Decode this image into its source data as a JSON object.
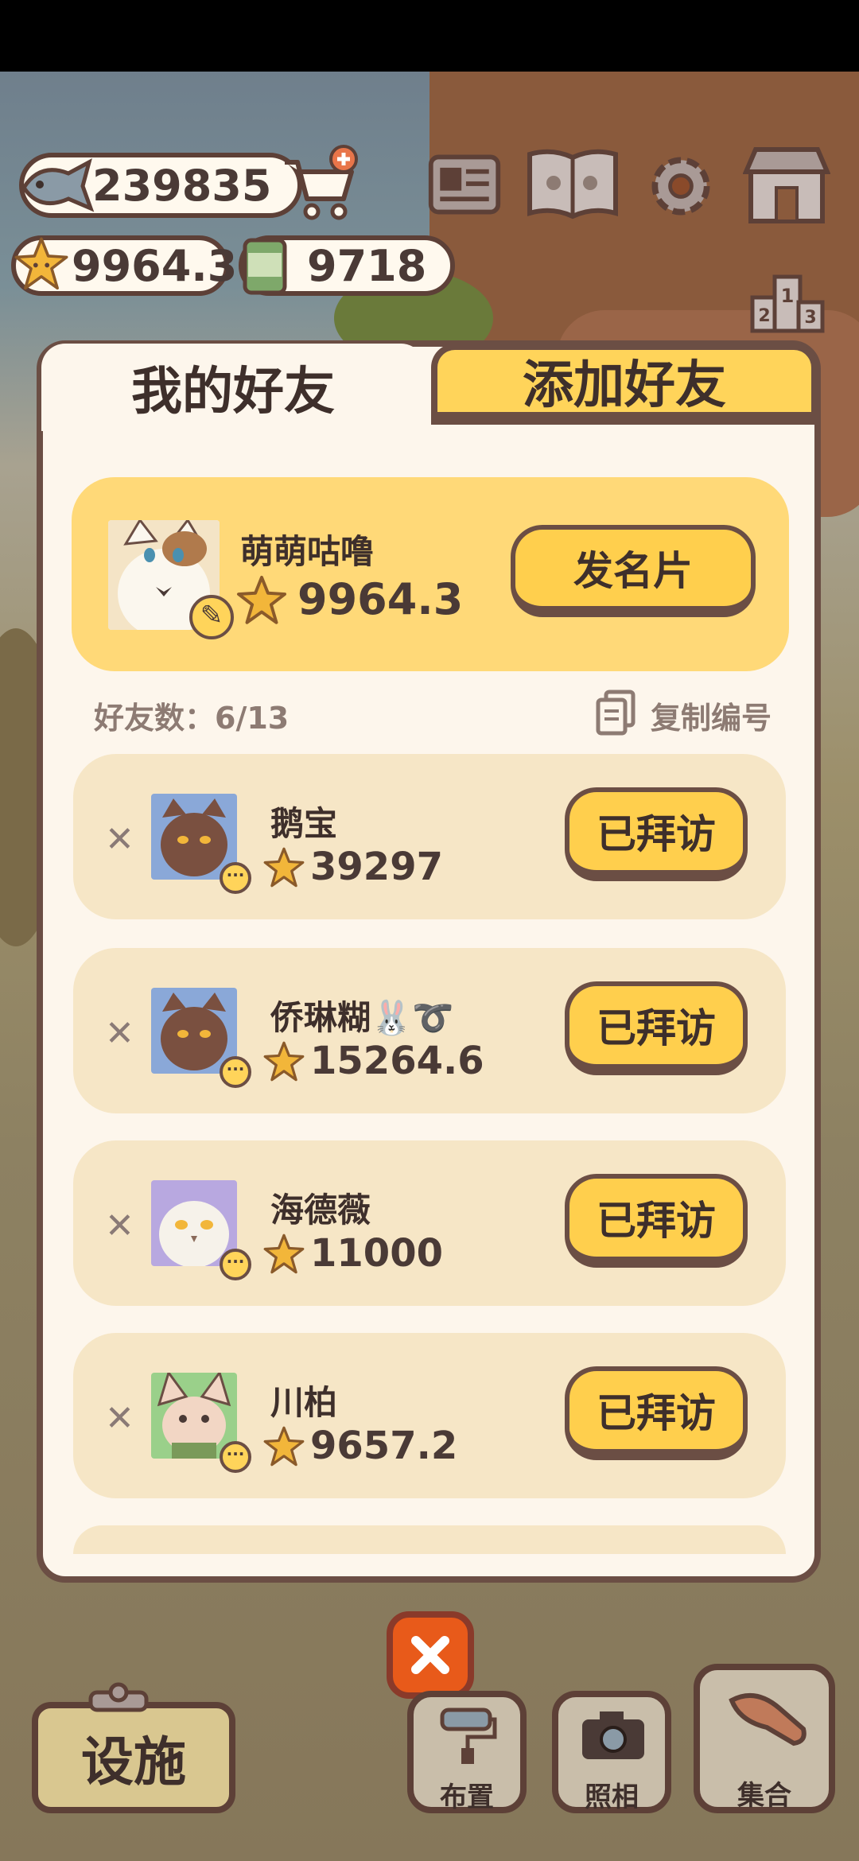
{
  "currency": {
    "fish": "239835",
    "stars": "9964.3",
    "cans": "9718"
  },
  "tabs": {
    "my_friends": "我的好友",
    "add_friend": "添加好友"
  },
  "me": {
    "name": "萌萌咕噜",
    "score": "9964.3",
    "card_button": "发名片"
  },
  "friends_meta": {
    "count_label": "好友数：6/13",
    "copy_id": "复制编号"
  },
  "friends": [
    {
      "name": "鹅宝",
      "score": "39297",
      "button": "已拜访"
    },
    {
      "name": "侨琳糊🐰➰",
      "score": "15264.6",
      "button": "已拜访"
    },
    {
      "name": "海德薇",
      "score": "11000",
      "button": "已拜访"
    },
    {
      "name": "川柏",
      "score": "9657.2",
      "button": "已拜访"
    }
  ],
  "bottom": {
    "facility": "设施",
    "arrange": "布置",
    "photo": "照相",
    "gather": "集合"
  },
  "colors": {
    "accent_yellow": "#ffcf4d",
    "panel_bg": "#fdf6ec",
    "row_bg": "#f6e6c6",
    "border": "#6b4e44",
    "close_red": "#e85a1a"
  },
  "icons": [
    "fish-icon",
    "cart-plus-icon",
    "star-icon",
    "can-icon",
    "profile-card-icon",
    "paw-book-icon",
    "gear-icon",
    "shop-icon",
    "podium-icon",
    "copy-icon",
    "close-icon",
    "roller-icon",
    "camera-icon",
    "whistle-icon",
    "clipboard-icon"
  ]
}
